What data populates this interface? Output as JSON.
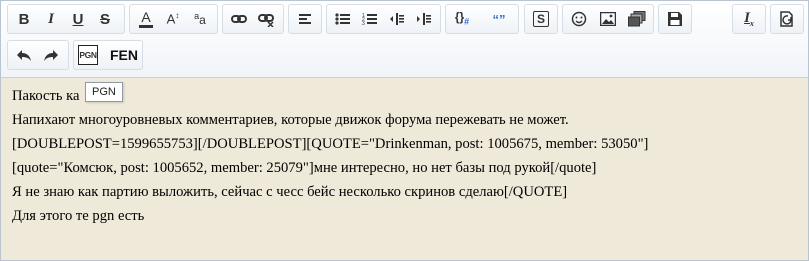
{
  "toolbar": {
    "formatting": [
      "bold-icon",
      "italic-icon",
      "underline-icon",
      "strikethrough-icon"
    ],
    "labels": {
      "bold": "B",
      "italic": "I",
      "underline": "U",
      "strike": "S",
      "font_color": "A",
      "font_size": "A",
      "font_family": "a",
      "clear_format": "I",
      "code": "{}",
      "spoiler": "S"
    },
    "pgn_button": "PGN",
    "fen_button": "FEN"
  },
  "tooltip": "PGN",
  "content": {
    "lines": [
      "Пакость ка",
      "Напихают многоуровневых комментариев, которые движок форума пережевать не может.",
      "[DOUBLEPOST=1599655753][/DOUBLEPOST][QUOTE=\"Drinkenman, post: 1005675, member: 53050\"]",
      "[quote=\"Комсюк, post: 1005652, member: 25079\"]мне интересно, но нет базы под рукой[/quote]",
      "Я не знаю как партию выложить, сейчас с чесс бейс несколько скринов сделаю[/QUOTE]",
      "Для этого те pgn есть"
    ]
  },
  "colors": {
    "editor_background": "#efe9d9",
    "toolbar_background": "#f1f4f8",
    "accent_blue": "#3b6cc4"
  }
}
